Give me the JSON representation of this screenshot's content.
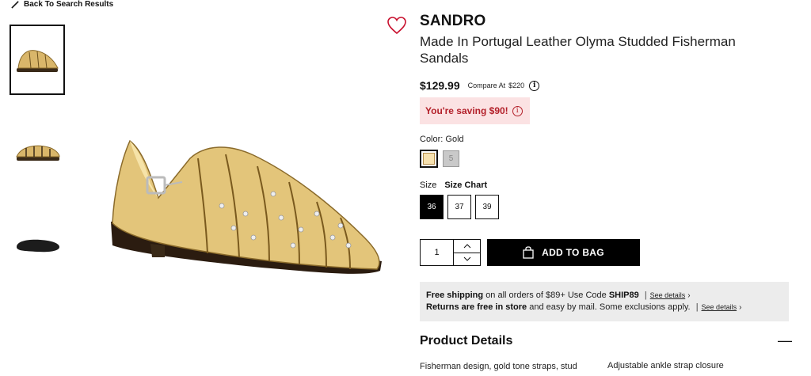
{
  "nav": {
    "back_label": "Back To Search Results"
  },
  "product": {
    "brand": "SANDRO",
    "title": "Made In Portugal Leather Olyma Studded Fisherman Sandals",
    "price": "$129.99",
    "compare_label": "Compare At",
    "compare_price": "$220",
    "saving_text": "You're saving $90!",
    "color_label": "Color:",
    "color_value": "Gold",
    "alt_swatch_glyph": "5",
    "size_label": "Size",
    "size_chart_label": "Size Chart",
    "sizes": [
      "36",
      "37",
      "39"
    ],
    "quantity": "1",
    "add_to_bag": "ADD TO BAG"
  },
  "shipping": {
    "line1_bold": "Free shipping",
    "line1_text": "on all orders of $89+ Use Code",
    "line1_code": "SHIP89",
    "line2_bold": "Returns are free in store",
    "line2_text": "and easy by mail. Some exclusions apply.",
    "see_details": "See details"
  },
  "details": {
    "heading": "Product Details",
    "col1_line1": "Fisherman design, gold tone straps, stud",
    "col2_line1": "Adjustable ankle strap closure"
  },
  "colors": {
    "accent_red": "#c8102e",
    "saving_bg": "#fbe2e3",
    "saving_text": "#b3202a",
    "gold": "#f7e2b0"
  },
  "icons": [
    "pencil-icon",
    "heart-icon",
    "info-icon",
    "bag-icon",
    "chevron-up-icon",
    "chevron-down-icon",
    "minus-icon"
  ]
}
